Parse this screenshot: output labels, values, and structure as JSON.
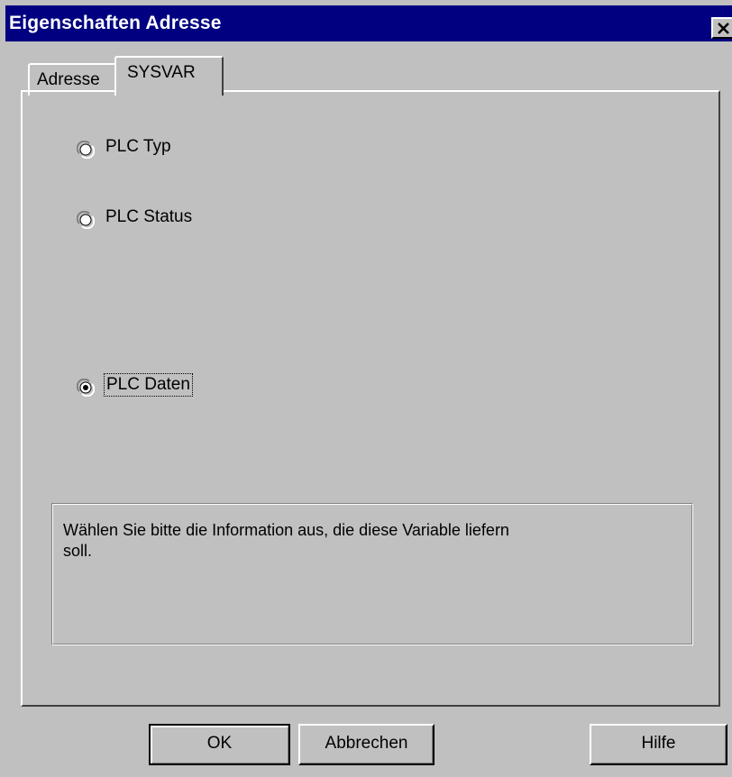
{
  "window": {
    "title": "Eigenschaften Adresse"
  },
  "tabs": [
    {
      "label": "Adresse",
      "selected": false
    },
    {
      "label": "SYSVAR",
      "selected": true
    }
  ],
  "options": [
    {
      "label": "PLC Typ",
      "checked": false
    },
    {
      "label": "PLC Status",
      "checked": false
    },
    {
      "label": "PLC Daten",
      "checked": true
    }
  ],
  "info": {
    "line1": "Wählen Sie bitte die Information aus, die diese Variable liefern",
    "line2": "soll."
  },
  "buttons": {
    "ok": "OK",
    "cancel": "Abbrechen",
    "help": "Hilfe"
  },
  "icons": {
    "close": "close-icon",
    "radio": "radio-icon"
  },
  "colors": {
    "titlebar": "#000080",
    "face": "#c0c0c0"
  }
}
